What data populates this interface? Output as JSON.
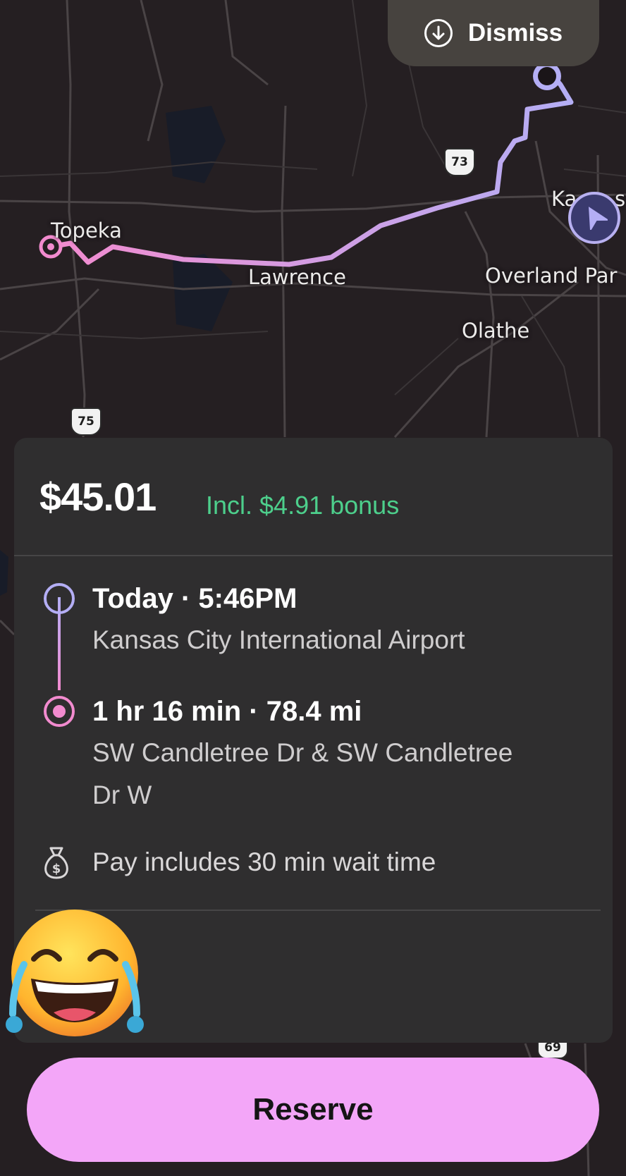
{
  "top_bar": {
    "dismiss_label": "Dismiss"
  },
  "map": {
    "cities": [
      "Topeka",
      "Lawrence",
      "Overland Par",
      "Olathe",
      "Ka",
      "s"
    ],
    "shields": [
      "73",
      "75",
      "69"
    ],
    "route_colors": {
      "start": "#b4aef5",
      "end": "#f28bcf"
    }
  },
  "offer": {
    "price": "$45.01",
    "bonus": "Incl. $4.91 bonus",
    "pickup": {
      "time": "Today · 5:46PM",
      "place": "Kansas City International Airport"
    },
    "dropoff": {
      "trip": "1 hr 16 min · 78.4 mi",
      "place": "SW Candletree Dr & SW Candletree Dr W"
    },
    "note": "Pay includes 30 min wait time"
  },
  "actions": {
    "reserve_label": "Reserve"
  },
  "colors": {
    "accent": "#f3a6f8",
    "bonus": "#4dcf8c",
    "card": "#2f2e2f",
    "map_bg": "#251f22"
  },
  "icons": [
    "arrow-down-circle-icon",
    "navigation-arrow-icon",
    "money-bag-icon",
    "laughing-emoji"
  ]
}
